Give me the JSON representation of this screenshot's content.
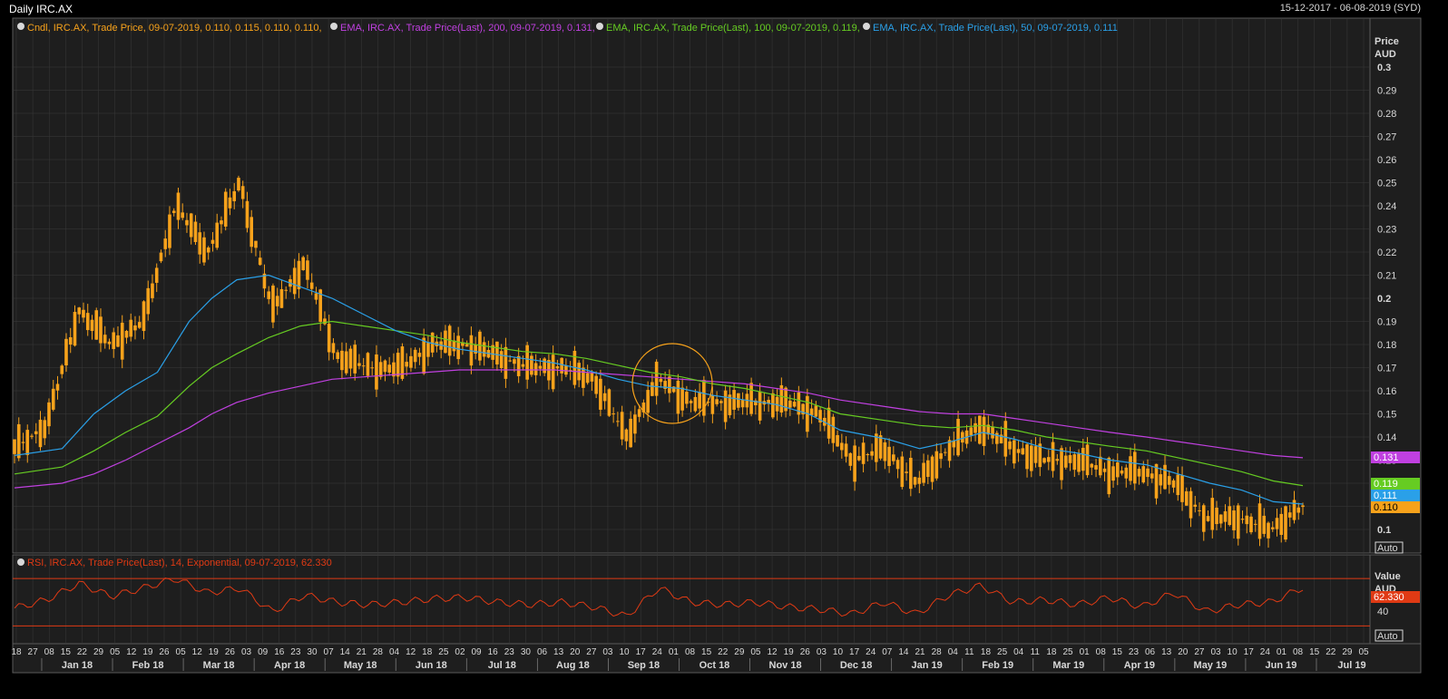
{
  "header": {
    "title": "Daily IRC.AX",
    "date_range": "15-12-2017 - 06-08-2019 (SYD)"
  },
  "colors": {
    "background": "#1e1e1e",
    "grid": "#3a3a3a",
    "candle": "#f7a21b",
    "ema200": "#c040e0",
    "ema100": "#66cc22",
    "ema50": "#2aa0e8",
    "rsi": "#e03a14",
    "axis_text": "#d8d8d8"
  },
  "price_panel": {
    "legend": [
      {
        "icon": "series-icon",
        "text": "Cndl, IRC.AX, Trade Price, 09-07-2019, 0.110, 0.115, 0.110, 0.110,",
        "color": "#f7a21b"
      },
      {
        "icon": "series-icon",
        "text": "EMA, IRC.AX, Trade Price(Last),  200, 09-07-2019, 0.131,",
        "color": "#c040e0"
      },
      {
        "icon": "series-icon",
        "text": "EMA, IRC.AX, Trade Price(Last),  100, 09-07-2019, 0.119,",
        "color": "#66cc22"
      },
      {
        "icon": "series-icon",
        "text": "EMA, IRC.AX, Trade Price(Last),  50, 09-07-2019, 0.111",
        "color": "#2aa0e8"
      }
    ],
    "axis_title": "Price",
    "axis_unit": "AUD",
    "yticks": [
      "0.3",
      "0.29",
      "0.28",
      "0.27",
      "0.26",
      "0.25",
      "0.24",
      "0.23",
      "0.22",
      "0.21",
      "0.2",
      "0.19",
      "0.18",
      "0.17",
      "0.16",
      "0.15",
      "0.14",
      "0.13",
      "0.12",
      "0.11",
      "0.1"
    ],
    "auto_label": "Auto",
    "value_tags": [
      {
        "text": "0.131",
        "color": "#c040e0"
      },
      {
        "text": "0.119",
        "color": "#66cc22"
      },
      {
        "text": "0.111",
        "color": "#2aa0e8"
      },
      {
        "text": "0.110",
        "color": "#f7a21b"
      }
    ]
  },
  "rsi_panel": {
    "legend": "RSI, IRC.AX, Trade Price(Last),  14, Exponential, 09-07-2019, 62.330",
    "axis_title": "Value",
    "axis_unit": "AUD",
    "ytick": "40",
    "value_tag": "62.330",
    "auto_label": "Auto"
  },
  "x_axis": {
    "day_labels": [
      "18",
      "27",
      "08",
      "15",
      "22",
      "29",
      "05",
      "12",
      "19",
      "26",
      "05",
      "12",
      "19",
      "26",
      "03",
      "09",
      "16",
      "23",
      "30",
      "07",
      "14",
      "21",
      "28",
      "04",
      "12",
      "18",
      "25",
      "02",
      "09",
      "16",
      "23",
      "30",
      "06",
      "13",
      "20",
      "27",
      "03",
      "10",
      "17",
      "24",
      "01",
      "08",
      "15",
      "22",
      "29",
      "05",
      "12",
      "19",
      "26",
      "03",
      "10",
      "17",
      "24",
      "07",
      "14",
      "21",
      "28",
      "04",
      "11",
      "18",
      "25",
      "04",
      "11",
      "18",
      "25",
      "01",
      "08",
      "15",
      "23",
      "06",
      "13",
      "20",
      "27",
      "03",
      "10",
      "17",
      "24",
      "01",
      "08",
      "15",
      "22",
      "29",
      "05"
    ],
    "month_labels": [
      "Jan 18",
      "Feb 18",
      "Mar 18",
      "Apr 18",
      "May 18",
      "Jun 18",
      "Jul 18",
      "Aug 18",
      "Sep 18",
      "Oct 18",
      "Nov 18",
      "Dec 18",
      "Jan 19",
      "Feb 19",
      "Mar 19",
      "Apr 19",
      "May 19",
      "Jun 19",
      "Jul 19"
    ]
  },
  "chart_data": {
    "type": "line",
    "title": "Daily IRC.AX",
    "date_range": "15-12-2017 - 06-08-2019",
    "ylim": [
      0.095,
      0.305
    ],
    "x": [
      "2017-12-18",
      "2018-01-08",
      "2018-01-22",
      "2018-02-05",
      "2018-02-19",
      "2018-03-05",
      "2018-03-15",
      "2018-03-26",
      "2018-04-09",
      "2018-04-23",
      "2018-05-07",
      "2018-05-21",
      "2018-06-04",
      "2018-06-18",
      "2018-07-02",
      "2018-07-16",
      "2018-07-30",
      "2018-08-13",
      "2018-08-27",
      "2018-09-10",
      "2018-09-24",
      "2018-10-08",
      "2018-10-22",
      "2018-11-05",
      "2018-11-19",
      "2018-12-03",
      "2018-12-17",
      "2019-01-07",
      "2019-01-21",
      "2019-02-04",
      "2019-02-18",
      "2019-03-04",
      "2019-03-18",
      "2019-04-01",
      "2019-04-15",
      "2019-05-01",
      "2019-05-15",
      "2019-05-29",
      "2019-06-12",
      "2019-06-26",
      "2019-07-09"
    ],
    "series": [
      {
        "name": "Cndl, IRC.AX, Trade Price",
        "values": [
          0.135,
          0.145,
          0.195,
          0.18,
          0.19,
          0.24,
          0.22,
          0.25,
          0.195,
          0.215,
          0.175,
          0.17,
          0.17,
          0.18,
          0.18,
          0.175,
          0.17,
          0.17,
          0.165,
          0.14,
          0.165,
          0.155,
          0.155,
          0.155,
          0.155,
          0.15,
          0.13,
          0.135,
          0.12,
          0.135,
          0.145,
          0.135,
          0.13,
          0.13,
          0.125,
          0.125,
          0.12,
          0.105,
          0.105,
          0.1,
          0.11
        ]
      },
      {
        "name": "EMA, IRC.AX, Trade Price(Last), 200",
        "values": [
          0.118,
          0.12,
          0.124,
          0.13,
          0.137,
          0.144,
          0.15,
          0.155,
          0.159,
          0.162,
          0.165,
          0.166,
          0.167,
          0.168,
          0.169,
          0.169,
          0.169,
          0.169,
          0.168,
          0.167,
          0.166,
          0.165,
          0.164,
          0.163,
          0.161,
          0.159,
          0.156,
          0.153,
          0.151,
          0.15,
          0.15,
          0.148,
          0.146,
          0.144,
          0.142,
          0.14,
          0.138,
          0.136,
          0.134,
          0.132,
          0.131
        ]
      },
      {
        "name": "EMA, IRC.AX, Trade Price(Last), 100",
        "values": [
          0.124,
          0.127,
          0.134,
          0.142,
          0.149,
          0.162,
          0.17,
          0.176,
          0.183,
          0.188,
          0.19,
          0.188,
          0.186,
          0.184,
          0.181,
          0.179,
          0.177,
          0.176,
          0.174,
          0.171,
          0.168,
          0.166,
          0.163,
          0.161,
          0.158,
          0.155,
          0.15,
          0.147,
          0.145,
          0.144,
          0.145,
          0.143,
          0.14,
          0.138,
          0.136,
          0.134,
          0.131,
          0.128,
          0.125,
          0.121,
          0.119
        ]
      },
      {
        "name": "EMA, IRC.AX, Trade Price(Last), 50",
        "values": [
          0.132,
          0.135,
          0.15,
          0.16,
          0.168,
          0.19,
          0.2,
          0.208,
          0.21,
          0.205,
          0.2,
          0.193,
          0.186,
          0.181,
          0.178,
          0.176,
          0.174,
          0.172,
          0.169,
          0.165,
          0.162,
          0.161,
          0.158,
          0.156,
          0.154,
          0.15,
          0.143,
          0.139,
          0.135,
          0.138,
          0.142,
          0.139,
          0.135,
          0.133,
          0.13,
          0.128,
          0.124,
          0.12,
          0.117,
          0.112,
          0.111
        ]
      },
      {
        "name": "RSI, IRC.AX, Trade Price(Last), 14, Exponential",
        "values": [
          45,
          52,
          66,
          55,
          62,
          70,
          58,
          62,
          42,
          56,
          50,
          48,
          50,
          53,
          54,
          50,
          48,
          50,
          46,
          38,
          62,
          50,
          48,
          50,
          46,
          44,
          40,
          50,
          40,
          56,
          64,
          50,
          52,
          48,
          54,
          46,
          58,
          42,
          48,
          50,
          62.33
        ]
      }
    ],
    "rsi_levels": [
      70,
      30
    ]
  }
}
